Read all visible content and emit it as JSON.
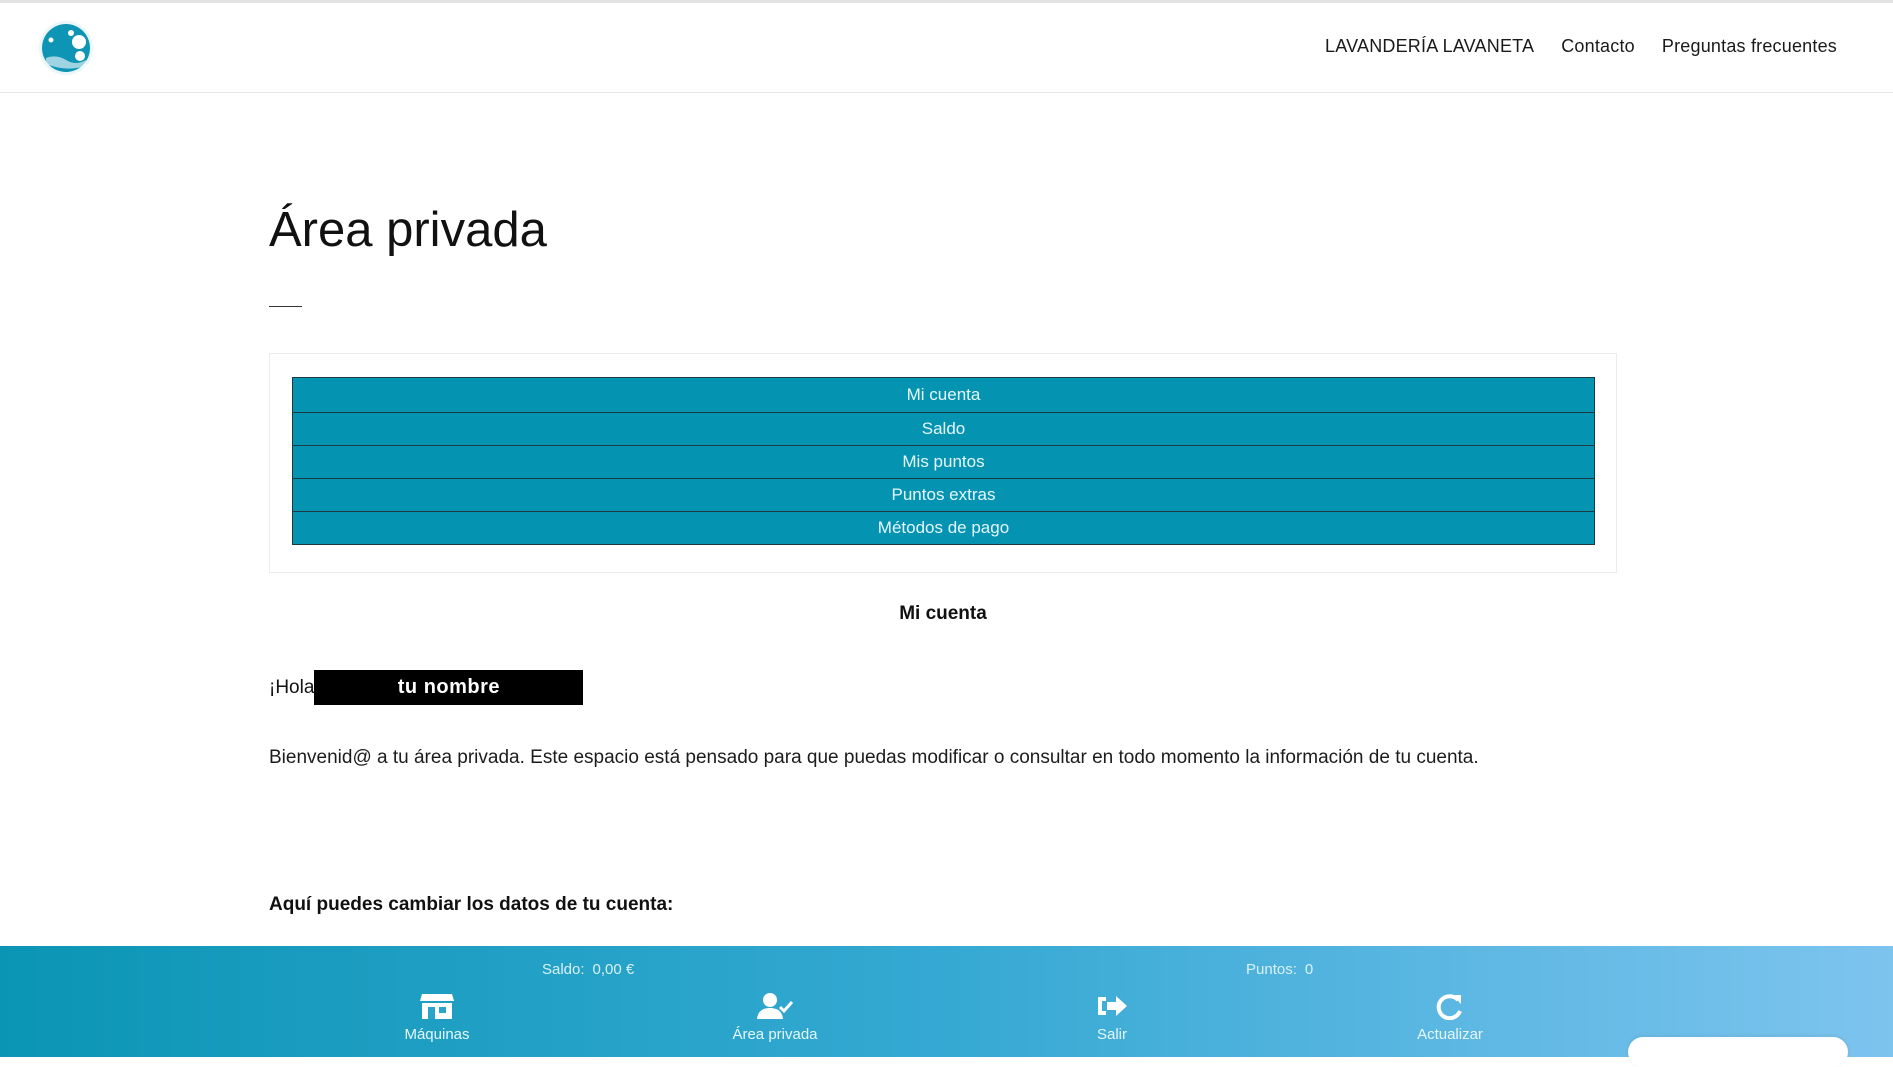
{
  "nav": {
    "brand_link": "LAVANDERÍA LAVANETA",
    "contact_link": "Contacto",
    "faq_link": "Preguntas frecuentes"
  },
  "page": {
    "title": "Área privada"
  },
  "tabs": [
    {
      "label": "Mi cuenta"
    },
    {
      "label": "Saldo"
    },
    {
      "label": "Mis puntos"
    },
    {
      "label": "Puntos extras"
    },
    {
      "label": "Métodos de pago"
    }
  ],
  "account": {
    "heading": "Mi cuenta",
    "greeting_prefix": "¡Hola",
    "name_placeholder": "tu nombre",
    "welcome_text": "Bienvenid@ a tu área privada. Este espacio está pensado para que puedas modificar o consultar en todo momento la información de tu cuenta.",
    "change_data_label": "Aquí puedes cambiar los datos de tu cuenta:"
  },
  "bottom_bar": {
    "balance_label": "Saldo:",
    "balance_value": "0,00 €",
    "points_label": "Puntos:",
    "points_value": "0",
    "buttons": [
      {
        "label": "Máquinas",
        "icon": "store-icon"
      },
      {
        "label": "Área privada",
        "icon": "user-check-icon"
      },
      {
        "label": "Salir",
        "icon": "sign-out-icon"
      },
      {
        "label": "Actualizar",
        "icon": "refresh-icon"
      }
    ]
  },
  "colors": {
    "tab_background": "#0593b2",
    "bar_gradient_start": "#0b95b5",
    "bar_gradient_end": "#7dc4ef"
  }
}
